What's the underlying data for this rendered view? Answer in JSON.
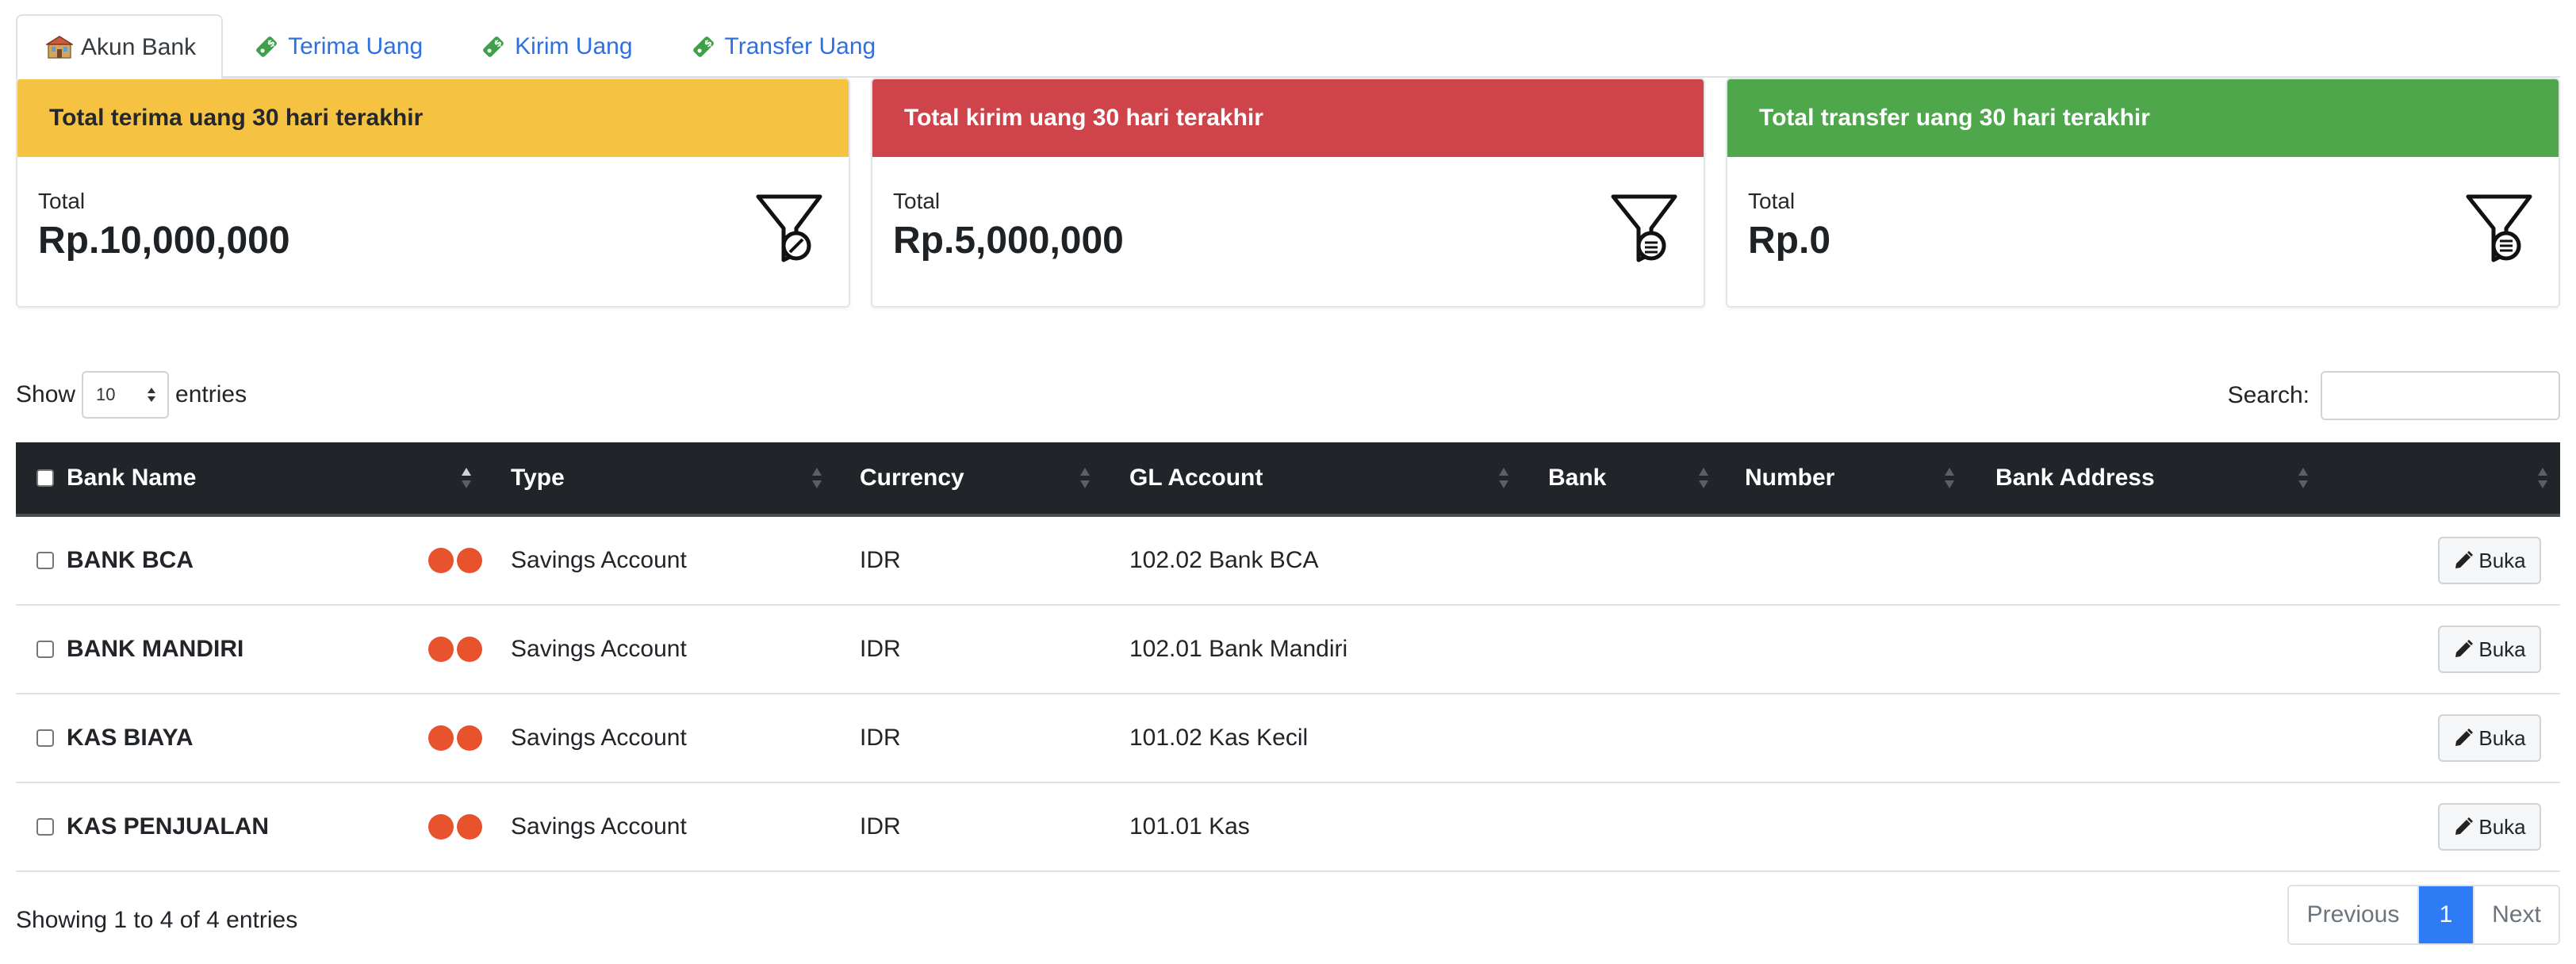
{
  "tabs": [
    {
      "label": "Akun Bank",
      "icon": "bank-building-icon",
      "active": true
    },
    {
      "label": "Terima Uang",
      "icon": "money-tag-icon",
      "active": false
    },
    {
      "label": "Kirim Uang",
      "icon": "money-tag-icon",
      "active": false
    },
    {
      "label": "Transfer Uang",
      "icon": "money-tag-icon",
      "active": false
    }
  ],
  "cards": [
    {
      "title": "Total terima uang 30 hari terakhir",
      "label": "Total",
      "value": "Rp.10,000,000",
      "color": "#f5c242",
      "icon": "funnel-icon"
    },
    {
      "title": "Total kirim uang 30 hari terakhir",
      "label": "Total",
      "value": "Rp.5,000,000",
      "color": "#cf444b",
      "icon": "funnel-icon"
    },
    {
      "title": "Total transfer uang 30 hari terakhir",
      "label": "Total",
      "value": "Rp.0",
      "color": "#4ea74b",
      "icon": "funnel-icon"
    }
  ],
  "controls": {
    "show_label": "Show",
    "entries_value": "10",
    "entries_label": "entries",
    "search_label": "Search:",
    "search_value": ""
  },
  "table": {
    "columns": [
      "Bank Name",
      "Type",
      "Currency",
      "GL Account",
      "Bank",
      "Number",
      "Bank Address"
    ],
    "rows": [
      {
        "name": "BANK BCA",
        "type": "Savings Account",
        "currency": "IDR",
        "gl": "102.02 Bank BCA",
        "bank": "",
        "number": "",
        "address": "",
        "action": "Buka"
      },
      {
        "name": "BANK MANDIRI",
        "type": "Savings Account",
        "currency": "IDR",
        "gl": "102.01 Bank Mandiri",
        "bank": "",
        "number": "",
        "address": "",
        "action": "Buka"
      },
      {
        "name": "KAS BIAYA",
        "type": "Savings Account",
        "currency": "IDR",
        "gl": "101.02 Kas Kecil",
        "bank": "",
        "number": "",
        "address": "",
        "action": "Buka"
      },
      {
        "name": "KAS PENJUALAN",
        "type": "Savings Account",
        "currency": "IDR",
        "gl": "101.01 Kas",
        "bank": "",
        "number": "",
        "address": "",
        "action": "Buka"
      }
    ]
  },
  "footer": {
    "info": "Showing 1 to 4 of 4 entries",
    "prev": "Previous",
    "current": "1",
    "next": "Next"
  },
  "colors": {
    "accent_blue": "#2f7bf5",
    "dot_orange": "#e8522c",
    "header_dark": "#212529"
  }
}
